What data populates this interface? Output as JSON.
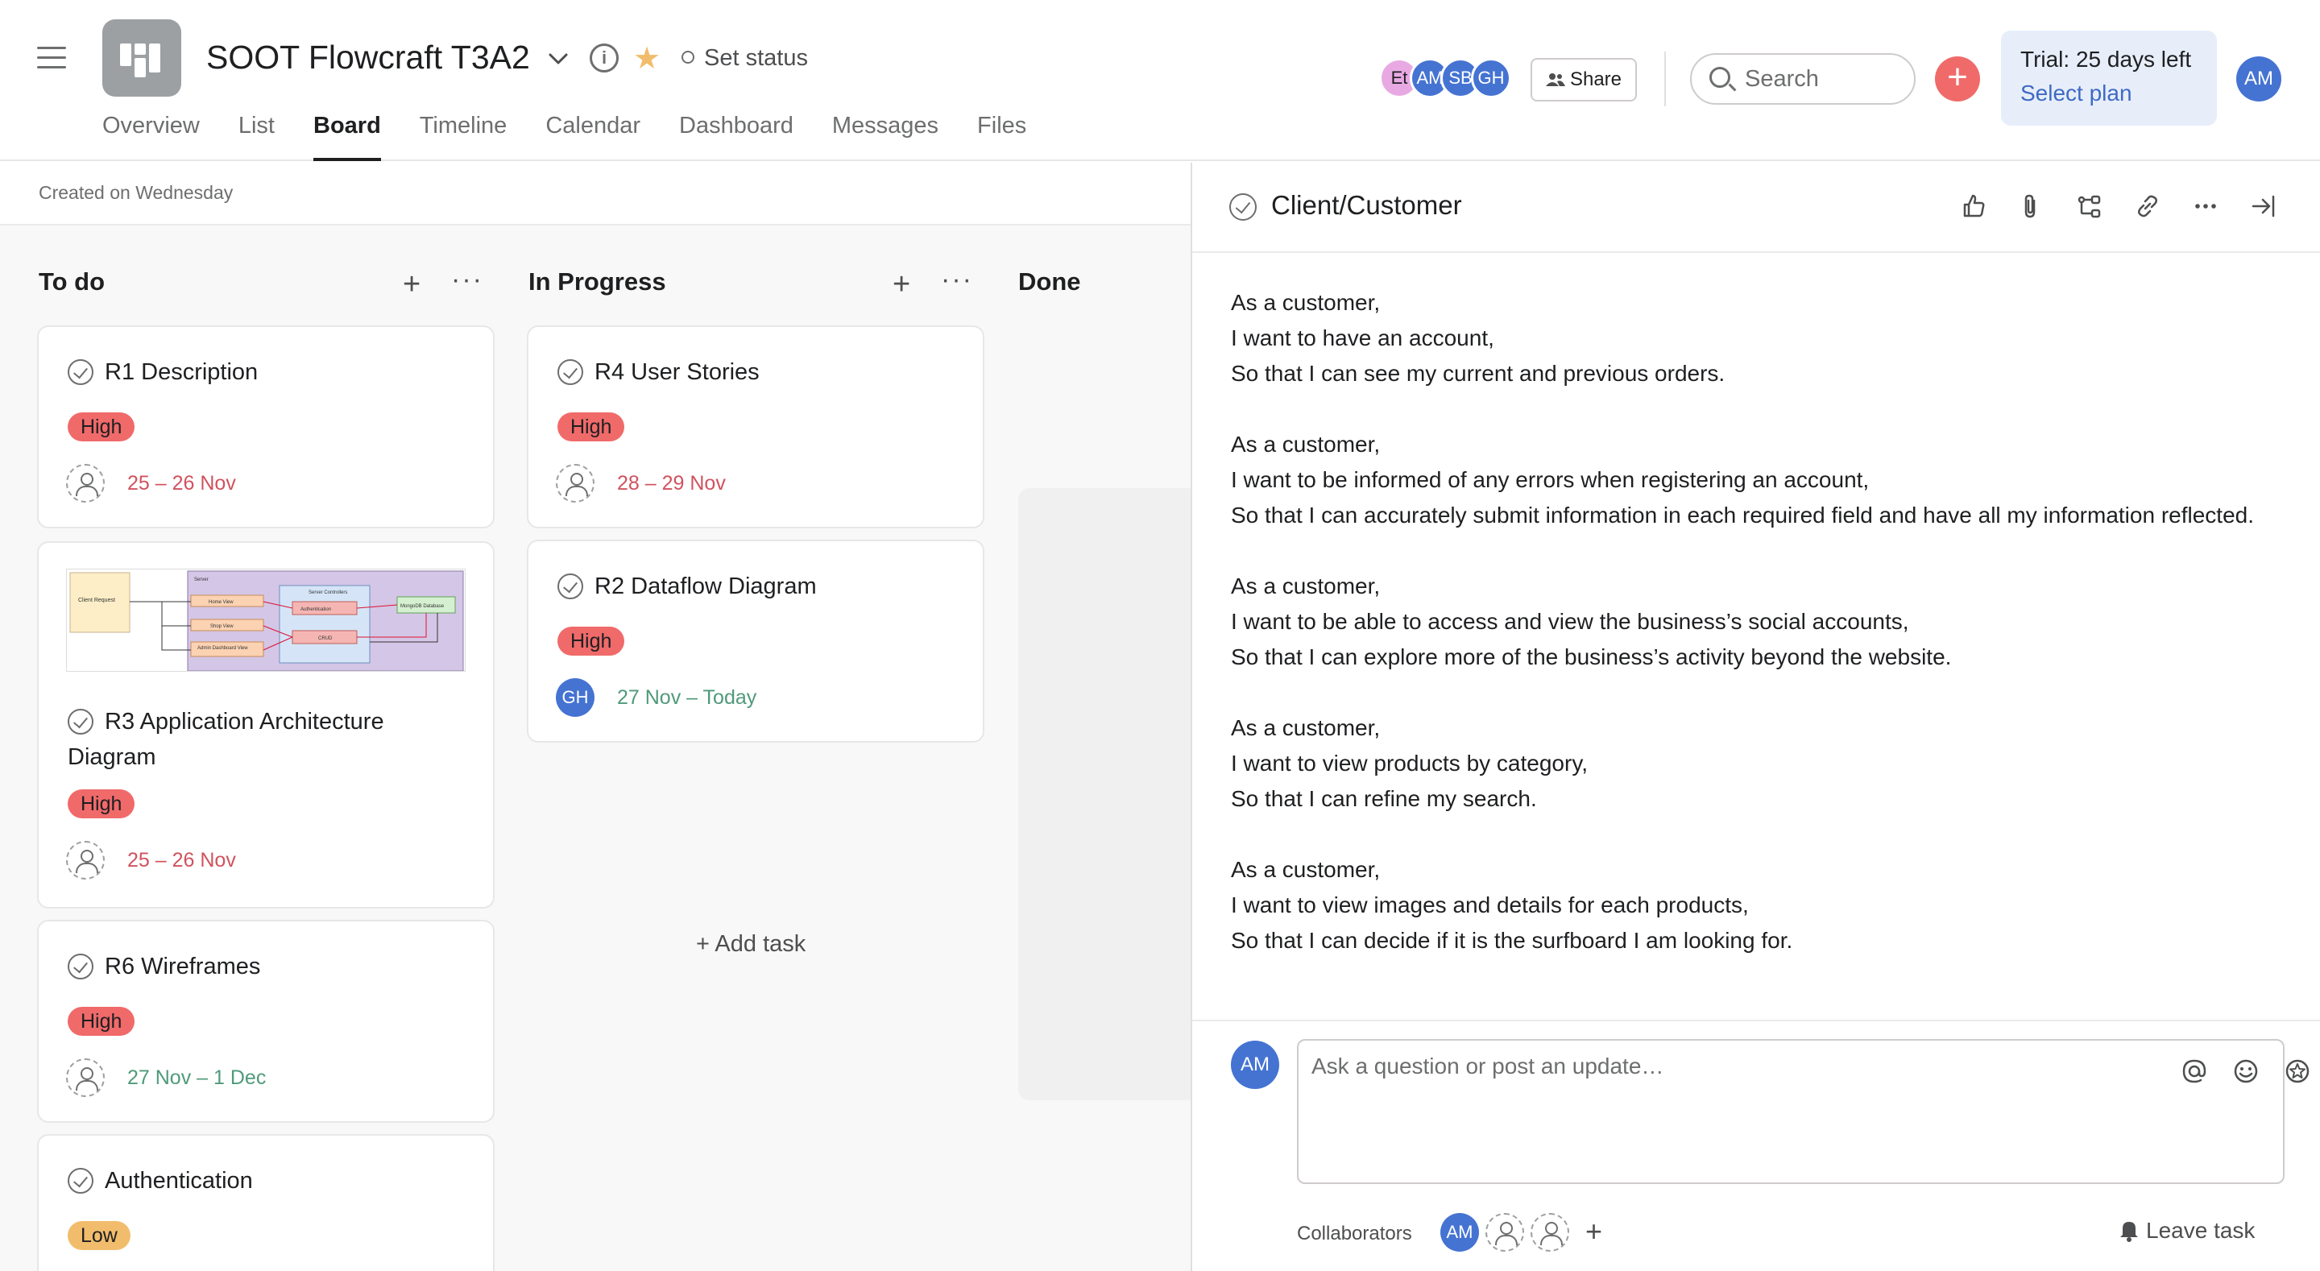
{
  "header": {
    "project_title": "SOOT Flowcraft T3A2",
    "set_status": "Set status",
    "share_label": "Share",
    "search_placeholder": "Search",
    "trial_text": "Trial: 25 days left",
    "select_plan": "Select plan",
    "current_user_initials": "AM",
    "members": [
      {
        "initials": "Et",
        "color": "#e8a9e3",
        "text_color": "#1e1f21"
      },
      {
        "initials": "AM",
        "color": "#4573d2",
        "text_color": "#ffffff"
      },
      {
        "initials": "SB",
        "color": "#4573d2",
        "text_color": "#ffffff"
      },
      {
        "initials": "GH",
        "color": "#4573d2",
        "text_color": "#ffffff"
      }
    ],
    "tabs": [
      "Overview",
      "List",
      "Board",
      "Timeline",
      "Calendar",
      "Dashboard",
      "Messages",
      "Files"
    ],
    "active_tab": "Board"
  },
  "board": {
    "created_text": "Created on Wednesday",
    "columns": [
      {
        "title": "To do"
      },
      {
        "title": "In Progress"
      },
      {
        "title": "Done"
      }
    ],
    "cards": {
      "r1": {
        "title": "R1 Description",
        "priority": "High",
        "date": "25 – 26 Nov"
      },
      "r3": {
        "title": "R3 Application Architecture Diagram",
        "priority": "High",
        "date": "25 – 26 Nov",
        "thumb_labels": [
          "Client Request",
          "Server",
          "Home View",
          "Shop View",
          "Admin Dashboard View",
          "Server Controllers",
          "Authentication",
          "CRUD",
          "MongoDB Database"
        ]
      },
      "r6": {
        "title": "R6 Wireframes",
        "priority": "High",
        "date": "27 Nov – 1 Dec"
      },
      "auth": {
        "title": "Authentication",
        "priority": "Low"
      },
      "r4": {
        "title": "R4 User Stories",
        "priority": "High",
        "date": "28 – 29 Nov"
      },
      "r2": {
        "title": "R2 Dataflow Diagram",
        "priority": "High",
        "date": "27 Nov – Today",
        "assignee": "GH"
      }
    },
    "add_task": "Add task"
  },
  "detail": {
    "title": "Client/Customer",
    "stories": [
      [
        "As a customer,",
        "I want to have an account,",
        "So that I can see my current and previous orders."
      ],
      [
        "As a customer,",
        "I want to be informed of any errors when registering an account,",
        "So that I can accurately submit information in each required field and have all my information reflected."
      ],
      [
        "As a customer,",
        "I want to be able to access and view the business’s social accounts,",
        "So that I can explore more of the business’s activity beyond the website."
      ],
      [
        "As a customer,",
        "I want to view products by category,",
        "So that I can refine my search."
      ],
      [
        "As a customer,",
        "I want to view images and details for each products,",
        "So that I can decide if it is the surfboard I am looking for."
      ]
    ],
    "composer_placeholder": "Ask a question or post an update…",
    "collaborators_label": "Collaborators",
    "collaborator_initials": "AM",
    "leave_task": "Leave task"
  }
}
